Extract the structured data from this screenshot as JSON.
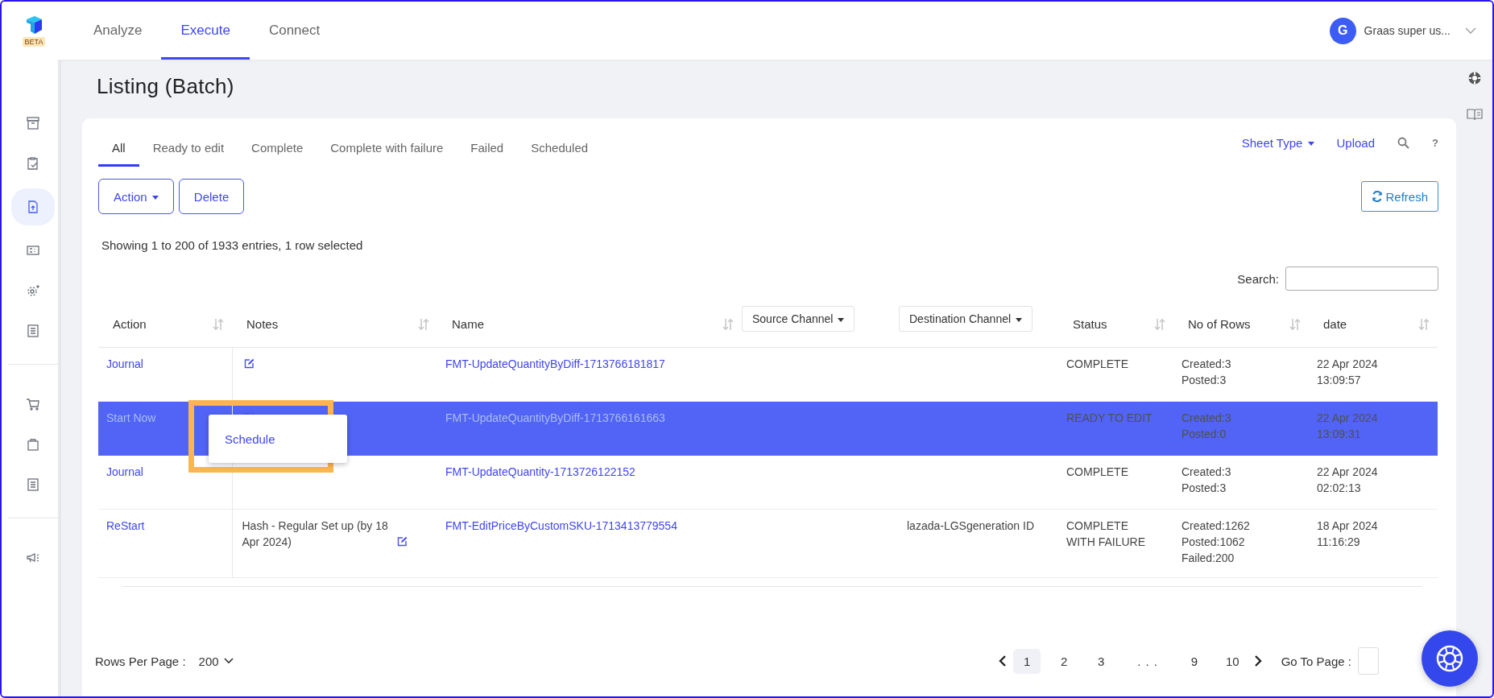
{
  "header": {
    "logo_badge": "BETA",
    "tabs": [
      {
        "label": "Analyze",
        "selected": false
      },
      {
        "label": "Execute",
        "selected": true
      },
      {
        "label": "Connect",
        "selected": false
      }
    ],
    "user": {
      "initial": "G",
      "name": "Graas super us..."
    }
  },
  "sidebar": {
    "groups": [
      [
        {
          "kind": "archive",
          "selected": false
        },
        {
          "kind": "clipboard",
          "selected": false
        },
        {
          "kind": "file-upload",
          "selected": true
        },
        {
          "kind": "card",
          "selected": false
        },
        {
          "kind": "gear",
          "selected": false
        },
        {
          "kind": "document",
          "selected": false
        }
      ],
      [
        {
          "kind": "cart",
          "selected": false
        },
        {
          "kind": "bag",
          "selected": false
        },
        {
          "kind": "document",
          "selected": false
        }
      ],
      [
        {
          "kind": "megaphone",
          "selected": false
        }
      ]
    ]
  },
  "page_title": "Listing (Batch)",
  "filter_tabs": [
    {
      "label": "All",
      "selected": true
    },
    {
      "label": "Ready to edit",
      "selected": false
    },
    {
      "label": "Complete",
      "selected": false
    },
    {
      "label": "Complete with failure",
      "selected": false
    },
    {
      "label": "Failed",
      "selected": false
    },
    {
      "label": "Scheduled",
      "selected": false
    }
  ],
  "toolbar": {
    "sheet_type": "Sheet Type",
    "upload": "Upload",
    "help": "?"
  },
  "buttons": {
    "action": "Action",
    "delete": "Delete",
    "refresh": "Refresh"
  },
  "summary": "Showing 1 to 200 of 1933 entries, 1 row selected",
  "search": {
    "label": "Search:"
  },
  "table": {
    "columns": [
      {
        "label": "Action",
        "kind": "sort"
      },
      {
        "label": "Notes",
        "kind": "sort"
      },
      {
        "label": "Name",
        "kind": "sort"
      },
      {
        "label": "Source Channel",
        "kind": "filter"
      },
      {
        "label": "Destination Channel",
        "kind": "filter"
      },
      {
        "label": "Status",
        "kind": "sort"
      },
      {
        "label": "No of Rows",
        "kind": "sort"
      },
      {
        "label": "date",
        "kind": "sort"
      }
    ],
    "rows": [
      {
        "selected": false,
        "action": "Journal",
        "note_icon": true,
        "name": "FMT-UpdateQuantityByDiff-1713766181817",
        "status": [
          "COMPLETE"
        ],
        "counts": [
          "Created:3",
          "Posted:3"
        ],
        "date": [
          "22 Apr 2024",
          "13:09:57"
        ]
      },
      {
        "selected": true,
        "action": "Start Now",
        "note_icon": true,
        "name": "FMT-UpdateQuantityByDiff-1713766161663",
        "status": [
          "READY TO EDIT"
        ],
        "counts": [
          "Created:3",
          "Posted:0"
        ],
        "date": [
          "22 Apr 2024",
          "13:09:31"
        ]
      },
      {
        "selected": false,
        "action": "Journal",
        "note_icon": false,
        "name": "FMT-UpdateQuantity-1713726122152",
        "status": [
          "COMPLETE"
        ],
        "counts": [
          "Created:3",
          "Posted:3"
        ],
        "date": [
          "22 Apr 2024",
          "02:02:13"
        ]
      },
      {
        "selected": false,
        "action": "ReStart",
        "notes": "Hash - Regular Set up (by 18 Apr 2024)",
        "note_icon": true,
        "name": "FMT-EditPriceByCustomSKU-1713413779554",
        "destination": "lazada-LGSgeneration ID",
        "status": [
          "COMPLETE",
          "WITH FAILURE"
        ],
        "counts": [
          "Created:1262",
          "Posted:1062",
          "Failed:200"
        ],
        "date": [
          "18 Apr 2024",
          "11:16:29"
        ]
      }
    ]
  },
  "context_menu": {
    "items": [
      "Schedule"
    ],
    "highlighted": true
  },
  "footer": {
    "rows_per_page_label": "Rows Per Page :",
    "rows_per_page": "200",
    "pages": [
      {
        "label": "1",
        "kind": "page",
        "selected": true
      },
      {
        "label": "2",
        "kind": "page",
        "selected": false
      },
      {
        "label": "3",
        "kind": "page",
        "selected": false
      },
      {
        "label": ". . .",
        "kind": "ellipsis"
      },
      {
        "label": "9",
        "kind": "page",
        "selected": false
      },
      {
        "label": "10",
        "kind": "page",
        "selected": false
      }
    ],
    "go_to_label": "Go To Page :"
  }
}
